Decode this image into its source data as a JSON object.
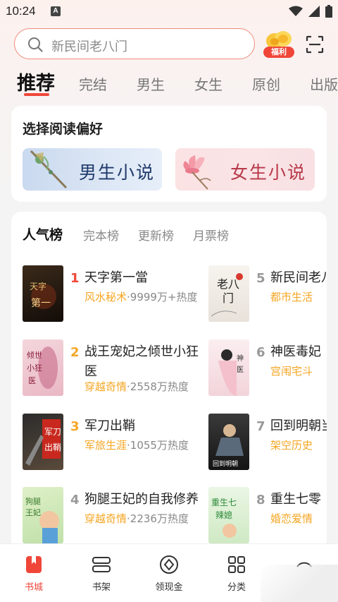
{
  "status_bar": {
    "time": "10:24",
    "badge": "A"
  },
  "search": {
    "placeholder": "新民间老八门",
    "welfare_label": "福利"
  },
  "tabs": [
    {
      "label": "推荐"
    },
    {
      "label": "完结"
    },
    {
      "label": "男生"
    },
    {
      "label": "女生"
    },
    {
      "label": "原创"
    },
    {
      "label": "出版"
    }
  ],
  "preference": {
    "title": "选择阅读偏好",
    "male_label": "男生小说",
    "female_label": "女生小说"
  },
  "ranking": {
    "tabs": [
      {
        "label": "人气榜"
      },
      {
        "label": "完本榜"
      },
      {
        "label": "更新榜"
      },
      {
        "label": "月票榜"
      }
    ],
    "books": [
      {
        "rank": "1",
        "title": "天字第一當",
        "genre": "风水秘术",
        "heat": "9999万+热度",
        "cover_text": "天字第一當"
      },
      {
        "rank": "2",
        "title": "战王宠妃之倾世小狂医",
        "genre": "穿越奇情",
        "heat": "2558万热度",
        "cover_text": "倾世小狂医"
      },
      {
        "rank": "3",
        "title": "军刀出鞘",
        "genre": "军旅生涯",
        "heat": "1055万热度",
        "cover_text": "军刀出鞘"
      },
      {
        "rank": "4",
        "title": "狗腿王妃的自我修养",
        "genre": "穿越奇情",
        "heat": "2236万热度",
        "cover_text": "狗腿王妃"
      },
      {
        "rank": "5",
        "title": "新民间老八门",
        "genre": "都市生活",
        "heat": "",
        "cover_text": "老八门"
      },
      {
        "rank": "6",
        "title": "神医毒妃",
        "genre": "宫闱宅斗",
        "heat": "",
        "cover_text": "神医毒妃"
      },
      {
        "rank": "7",
        "title": "回到明朝当少爷",
        "genre": "架空历史",
        "heat": "",
        "cover_text": "回到明朝当少爷"
      },
      {
        "rank": "8",
        "title": "重生七零",
        "genre": "婚恋爱情",
        "heat": "",
        "cover_text": "重生七零辣媳"
      }
    ]
  },
  "bottom_nav": [
    {
      "label": "书城",
      "icon": "bookstore-icon"
    },
    {
      "label": "书架",
      "icon": "bookshelf-icon"
    },
    {
      "label": "领现金",
      "icon": "cash-icon"
    },
    {
      "label": "分类",
      "icon": "category-icon"
    },
    {
      "label": "",
      "icon": "profile-icon"
    }
  ],
  "colors": {
    "accent": "#f0463a",
    "genre": "#f5a623"
  }
}
